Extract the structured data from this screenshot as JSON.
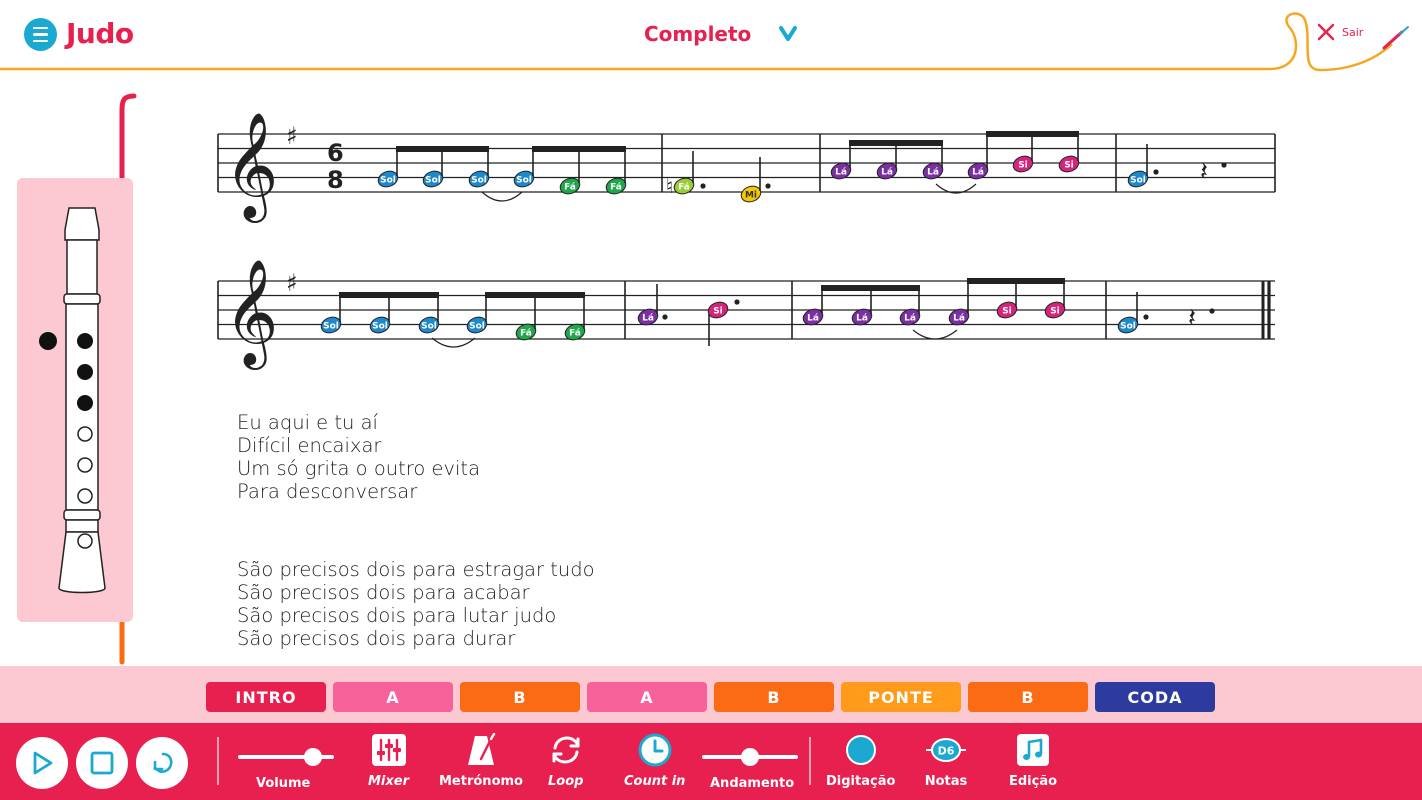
{
  "header": {
    "title": "Judo",
    "mode": "Completo",
    "exit_label": "Sair"
  },
  "lyrics": {
    "stanza1": [
      "Eu aqui e tu aí",
      "Difícil encaixar",
      "Um só grita o outro evita",
      "Para desconversar"
    ],
    "stanza2": [
      "São precisos dois para estragar tudo",
      "São precisos dois para acabar",
      "São precisos dois para lutar judo",
      "São precisos dois para durar"
    ]
  },
  "score": {
    "time_signature": [
      "6",
      "8"
    ],
    "note_colors": {
      "Sol": "#1e88c9",
      "Fá": "#1fa84a",
      "Fá♮": "#9acd32",
      "Mi": "#f5c800",
      "Lá": "#7b2fa3",
      "Si": "#d6247e"
    },
    "staff1": [
      [
        "Sol",
        "Sol",
        "Sol",
        "Sol",
        "Fá",
        "Fá"
      ],
      [
        "Fá♮",
        "Mi"
      ],
      [
        "Lá",
        "Lá",
        "Lá",
        "Lá",
        "Si",
        "Si"
      ],
      [
        "Sol"
      ]
    ],
    "staff2": [
      [
        "Sol",
        "Sol",
        "Sol",
        "Sol",
        "Fá",
        "Fá"
      ],
      [
        "Lá",
        "Si"
      ],
      [
        "Lá",
        "Lá",
        "Lá",
        "Lá",
        "Si",
        "Si"
      ],
      [
        "Sol"
      ]
    ]
  },
  "sections": [
    {
      "label": "INTRO",
      "color": "#e8204f"
    },
    {
      "label": "A",
      "color": "#f7629a"
    },
    {
      "label": "B",
      "color": "#fa6b14"
    },
    {
      "label": "A",
      "color": "#f7629a"
    },
    {
      "label": "B",
      "color": "#fa6b14"
    },
    {
      "label": "PONTE",
      "color": "#ff9a1a"
    },
    {
      "label": "B",
      "color": "#fa6b14"
    },
    {
      "label": "CODA",
      "color": "#2d3a9e"
    }
  ],
  "toolbar": {
    "play_icon": "play-icon",
    "stop_icon": "stop-icon",
    "rewind_icon": "rewind-icon",
    "volume_label": "Volume",
    "volume_level": 0.78,
    "mixer_label": "Mixer",
    "metronome_label": "Metrónomo",
    "loop_label": "Loop",
    "count_in_label": "Count in",
    "tempo_label": "Andamento",
    "tempo_level": 0.5,
    "fingering_label": "Digitação",
    "notes_label": "Notas",
    "notes_icon_text": "D6",
    "edit_label": "Edição"
  },
  "recorder": {
    "thumb_hole": "closed",
    "holes": [
      "closed",
      "closed",
      "closed",
      "open",
      "open",
      "open",
      "open"
    ]
  }
}
